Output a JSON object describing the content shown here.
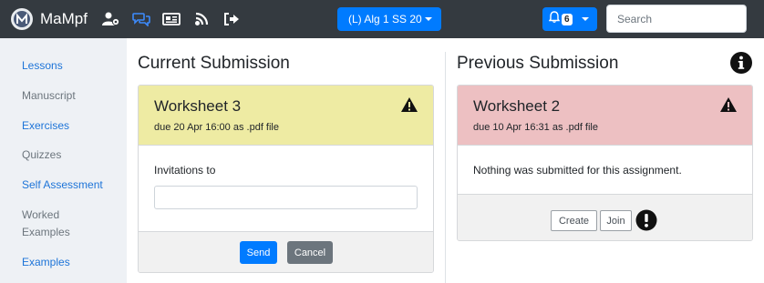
{
  "colors": {
    "navbar": "#343a40",
    "primary": "#007bff",
    "secondary": "#6c757d",
    "current_header": "#eeeba3",
    "previous_header": "#edc0c2",
    "sidebar_link": "#1d74d8"
  },
  "navbar": {
    "brand_name": "MaMpf",
    "icons": [
      "user-cog-icon",
      "comments-icon",
      "newspaper-icon",
      "blog-icon",
      "sign-out-icon"
    ],
    "lecture_select": "(L) Alg 1 SS 20",
    "notification_count": "6",
    "search_placeholder": "Search"
  },
  "sidebar": {
    "items": [
      {
        "label": "Lessons",
        "active": true
      },
      {
        "label": "Manuscript",
        "active": false
      },
      {
        "label": "Exercises",
        "active": true
      },
      {
        "label": "Quizzes",
        "active": false
      },
      {
        "label": "Self Assessment",
        "active": true
      },
      {
        "label": "Worked Examples",
        "active": false
      },
      {
        "label": "Examples",
        "active": true
      }
    ]
  },
  "current": {
    "heading": "Current Submission",
    "title": "Worksheet 3",
    "due": "due 20 Apr 16:00 as .pdf file",
    "invitations_label": "Invitations to",
    "invitations_value": "",
    "send_label": "Send",
    "cancel_label": "Cancel"
  },
  "previous": {
    "heading": "Previous Submission",
    "title": "Worksheet 2",
    "due": "due 10 Apr 16:31 as .pdf file",
    "message": "Nothing was submitted for this assignment.",
    "create_label": "Create",
    "join_label": "Join"
  }
}
